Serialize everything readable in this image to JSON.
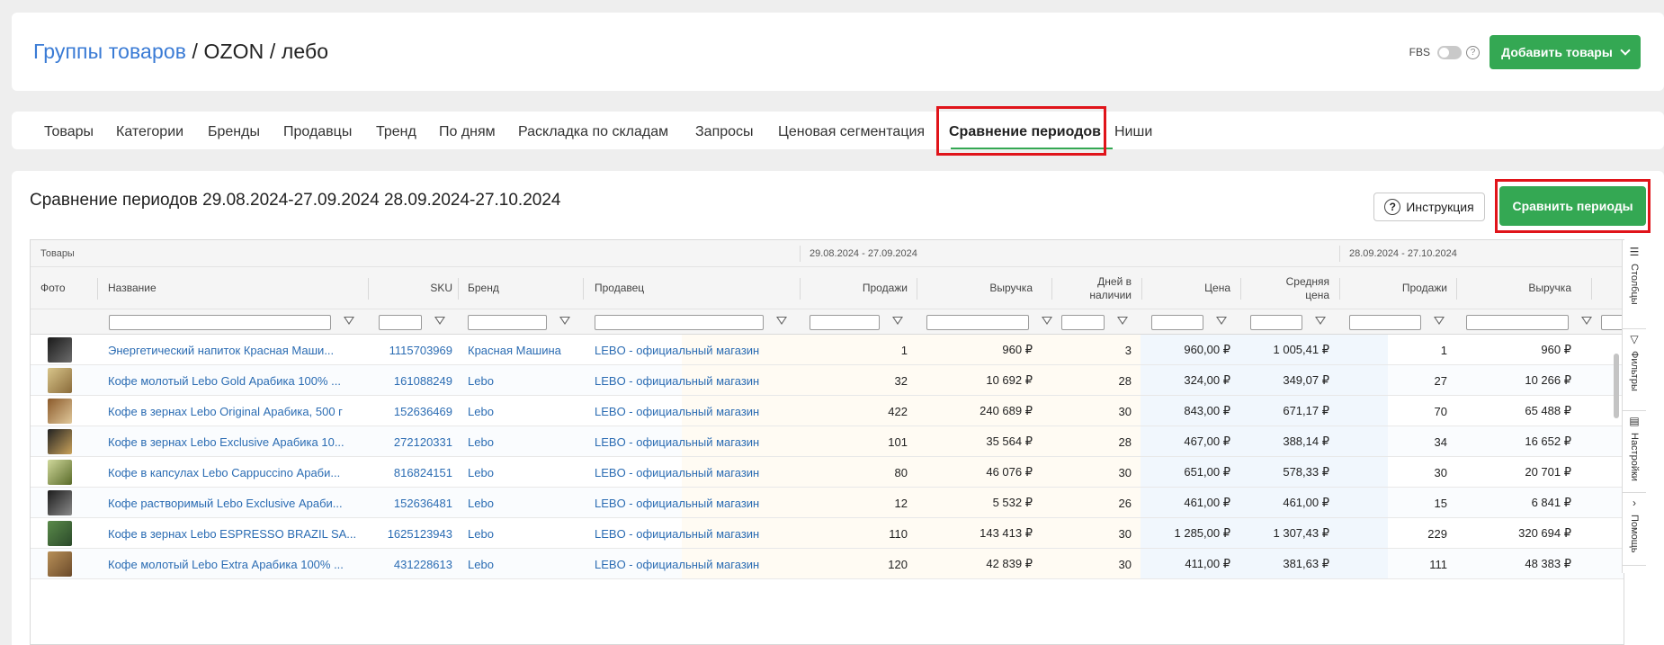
{
  "header": {
    "breadcrumb_link": "Группы товаров",
    "breadcrumb_sep1": " / ",
    "breadcrumb_part2": "OZON",
    "breadcrumb_sep2": " / ",
    "breadcrumb_part3": "лебо",
    "fbs_label": "FBS",
    "fbs_enabled": false,
    "help_icon": "?",
    "add_button": "Добавить товары"
  },
  "tabs": [
    {
      "label": "Товары",
      "active": false
    },
    {
      "label": "Категории",
      "active": false
    },
    {
      "label": "Бренды",
      "active": false
    },
    {
      "label": "Продавцы",
      "active": false
    },
    {
      "label": "Тренд",
      "active": false
    },
    {
      "label": "По дням",
      "active": false
    },
    {
      "label": "Раскладка по складам",
      "active": false
    },
    {
      "label": "Запросы",
      "active": false
    },
    {
      "label": "Ценовая сегментация",
      "active": false
    },
    {
      "label": "Сравнение периодов",
      "active": true
    },
    {
      "label": "Ниши",
      "active": false
    }
  ],
  "main": {
    "title": "Сравнение периодов 29.08.2024-27.09.2024 28.09.2024-27.10.2024",
    "instruction_button": "Инструкция",
    "instruction_icon": "?",
    "compare_button": "Сравнить периоды"
  },
  "table": {
    "groups": [
      "Товары",
      "29.08.2024 - 27.09.2024",
      "28.09.2024 - 27.10.2024"
    ],
    "columns": {
      "photo": "Фото",
      "name": "Название",
      "sku": "SKU",
      "brand": "Бренд",
      "seller": "Продавец",
      "p1_sales": "Продажи",
      "p1_revenue": "Выручка",
      "p1_days_line1": "Дней в",
      "p1_days_line2": "наличии",
      "p1_price": "Цена",
      "p1_avg_line1": "Средняя",
      "p1_avg_line2": "цена",
      "p2_sales": "Продажи",
      "p2_revenue": "Выручка"
    },
    "rows": [
      {
        "name": "Энергетический напиток Красная Маши...",
        "sku": "1115703969",
        "brand": "Красная Машина",
        "seller": "LEBO - официальный магазин",
        "sales1": "1",
        "revenue1": "960 ₽",
        "days1": "3",
        "price1": "960,00 ₽",
        "avg1": "1 005,41 ₽",
        "sales2": "1",
        "revenue2": "960 ₽"
      },
      {
        "name": "Кофе молотый Lebo Gold Арабика 100% ...",
        "sku": "161088249",
        "brand": "Lebo",
        "seller": "LEBO - официальный магазин",
        "sales1": "32",
        "revenue1": "10 692 ₽",
        "days1": "28",
        "price1": "324,00 ₽",
        "avg1": "349,07 ₽",
        "sales2": "27",
        "revenue2": "10 266 ₽"
      },
      {
        "name": "Кофе в зернах Lebo Original Арабика, 500 г",
        "sku": "152636469",
        "brand": "Lebo",
        "seller": "LEBO - официальный магазин",
        "sales1": "422",
        "revenue1": "240 689 ₽",
        "days1": "30",
        "price1": "843,00 ₽",
        "avg1": "671,17 ₽",
        "sales2": "70",
        "revenue2": "65 488 ₽"
      },
      {
        "name": "Кофе в зернах Lebo Exclusive Арабика 10...",
        "sku": "272120331",
        "brand": "Lebo",
        "seller": "LEBO - официальный магазин",
        "sales1": "101",
        "revenue1": "35 564 ₽",
        "days1": "28",
        "price1": "467,00 ₽",
        "avg1": "388,14 ₽",
        "sales2": "34",
        "revenue2": "16 652 ₽"
      },
      {
        "name": "Кофе в капсулах Lebo Cappuccino Араби...",
        "sku": "816824151",
        "brand": "Lebo",
        "seller": "LEBO - официальный магазин",
        "sales1": "80",
        "revenue1": "46 076 ₽",
        "days1": "30",
        "price1": "651,00 ₽",
        "avg1": "578,33 ₽",
        "sales2": "30",
        "revenue2": "20 701 ₽"
      },
      {
        "name": "Кофе растворимый Lebo Exclusive Араби...",
        "sku": "152636481",
        "brand": "Lebo",
        "seller": "LEBO - официальный магазин",
        "sales1": "12",
        "revenue1": "5 532 ₽",
        "days1": "26",
        "price1": "461,00 ₽",
        "avg1": "461,00 ₽",
        "sales2": "15",
        "revenue2": "6 841 ₽"
      },
      {
        "name": "Кофе в зернах Lebo ESPRESSO BRAZIL SA...",
        "sku": "1625123943",
        "brand": "Lebo",
        "seller": "LEBO - официальный магазин",
        "sales1": "110",
        "revenue1": "143 413 ₽",
        "days1": "30",
        "price1": "1 285,00 ₽",
        "avg1": "1 307,43 ₽",
        "sales2": "229",
        "revenue2": "320 694 ₽"
      },
      {
        "name": "Кофе молотый Lebo Extra Арабика 100% ...",
        "sku": "431228613",
        "brand": "Lebo",
        "seller": "LEBO - официальный магазин",
        "sales1": "120",
        "revenue1": "42 839 ₽",
        "days1": "30",
        "price1": "411,00 ₽",
        "avg1": "381,63 ₽",
        "sales2": "111",
        "revenue2": "48 383 ₽"
      }
    ]
  },
  "side_panel": {
    "columns": "Столбцы",
    "filters": "Фильтры",
    "settings": "Настройки",
    "help": "Помощь"
  },
  "colors": {
    "accent_green": "#34a853",
    "link_blue": "#2b6cb3",
    "highlight_red": "#e0141a"
  }
}
